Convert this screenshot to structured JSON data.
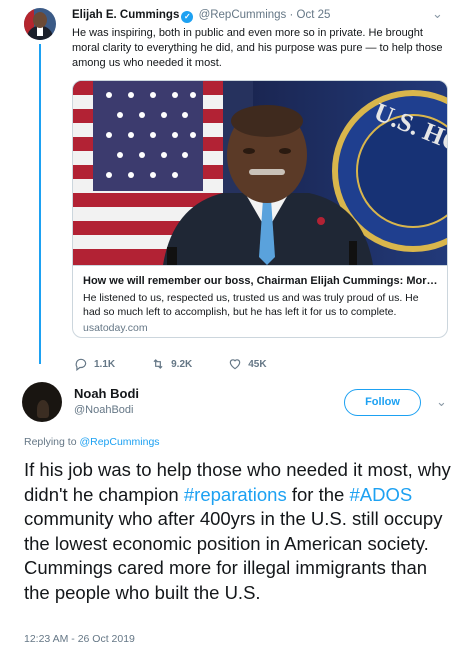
{
  "parent_tweet": {
    "author_name": "Elijah E. Cummings",
    "handle": "@RepCummings",
    "separator": "·",
    "date": "Oct 25",
    "text": "He was inspiring, both in public and even more so in private. He brought moral clarity to everything he did, and his purpose was pure — to help those among us who needed it most.",
    "card": {
      "title": "How we will remember our boss, Chairman Elijah Cummings: Moral ...",
      "description": "He listened to us, respected us, trusted us and was truly proud of us. He had so much left to accomplish, but he has left it for us to complete.",
      "domain": "usatoday.com"
    },
    "actions": {
      "reply_count": "1.1K",
      "retweet_count": "9.2K",
      "like_count": "45K"
    },
    "icons": {
      "verified": "verified-badge-icon",
      "caret": "chevron-down-icon",
      "reply": "reply-icon",
      "retweet": "retweet-icon",
      "like": "heart-icon"
    }
  },
  "reply_tweet": {
    "author_name": "Noah Bodi",
    "handle": "@NoahBodi",
    "follow_label": "Follow",
    "replying_prefix": "Replying to",
    "replying_to": "@RepCummings",
    "text_parts": {
      "p1": "If his job was to help those who needed it most, why didn't he champion ",
      "tag1": "#reparations",
      "p2": " for the ",
      "tag2": "#ADOS",
      "p3": " community who after 400yrs in the U.S. still occupy the lowest economic position in American society. Cummings cared more for illegal immigrants than the people who built the U.S."
    },
    "timestamp": "12:23 AM - 26 Oct 2019"
  },
  "colors": {
    "accent": "#1da1f2",
    "text": "#14171a",
    "muted": "#657786",
    "border": "#ccd6dd"
  }
}
